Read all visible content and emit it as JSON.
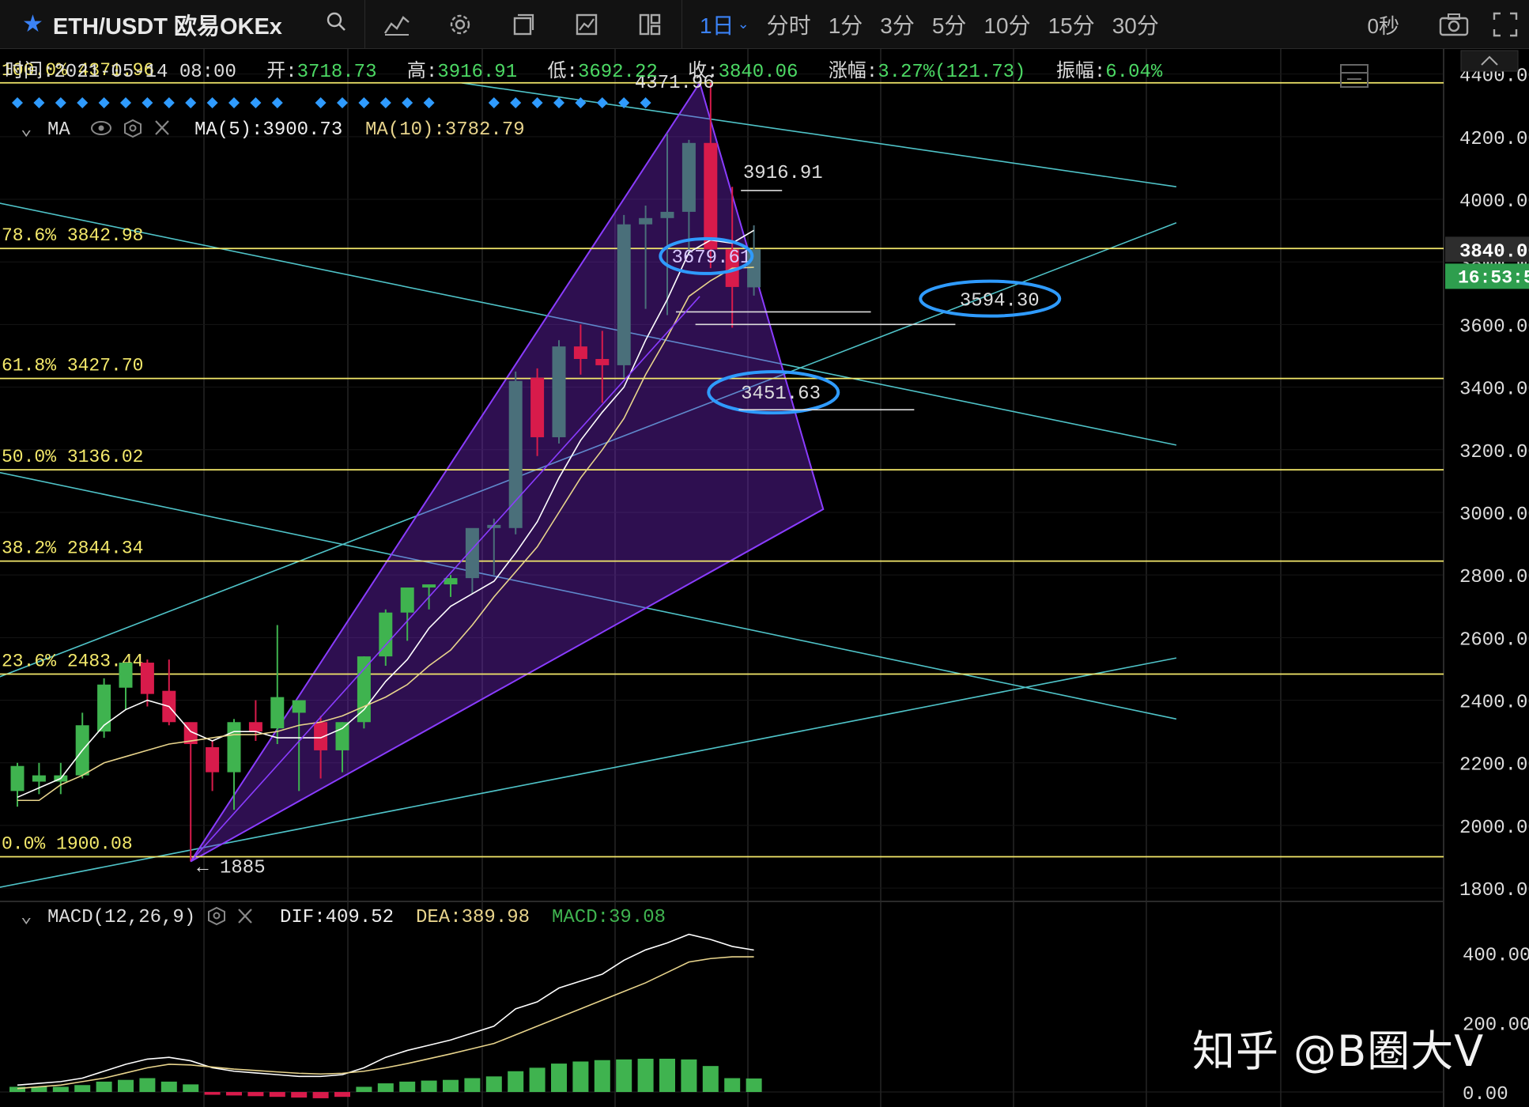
{
  "toolbar": {
    "symbol": "ETH/USDT 欧易OKEx",
    "intervals": [
      "1日",
      "分时",
      "1分",
      "3分",
      "5分",
      "10分",
      "15分",
      "30分"
    ],
    "active_interval": "1日",
    "countdown": "0秒"
  },
  "ohlc_bar": {
    "time_label": "时间:",
    "time": "2021-05-14 08:00",
    "open_label": "开:",
    "open": "3718.73",
    "high_label": "高:",
    "high": "3916.91",
    "low_label": "低:",
    "low": "3692.22",
    "close_label": "收:",
    "close": "3840.06",
    "change_label": "涨幅:",
    "change": "3.27%(121.73)",
    "amplitude_label": "振幅:",
    "amplitude": "6.04%"
  },
  "ma_legend": {
    "name": "MA",
    "ma5": "MA(5):3900.73",
    "ma10": "MA(10):3782.79"
  },
  "macd_legend": {
    "name": "MACD(12,26,9)",
    "dif": "DIF:409.52",
    "dea": "DEA:389.98",
    "macd": "MACD:39.08"
  },
  "price_axis": {
    "ticks": [
      "4400.00",
      "4200.00",
      "4000.00",
      "3800.00",
      "3600.00",
      "3400.00",
      "3200.00",
      "3000.00",
      "2800.00",
      "2600.00",
      "2400.00",
      "2200.00",
      "2000.00",
      "1800.00"
    ],
    "last_price": "3840.06",
    "countdown": "16:53:52"
  },
  "macd_axis": {
    "ticks": [
      "400.00",
      "200.00",
      "0.00"
    ]
  },
  "fib_levels": [
    {
      "label": "100.0% 4371.96",
      "value": 4371.96
    },
    {
      "label": "78.6% 3842.98",
      "value": 3842.98
    },
    {
      "label": "61.8% 3427.70",
      "value": 3427.7
    },
    {
      "label": "50.0% 3136.02",
      "value": 3136.02
    },
    {
      "label": "38.2% 2844.34",
      "value": 2844.34
    },
    {
      "label": "23.6% 2483.44",
      "value": 2483.44
    },
    {
      "label": "0.0% 1900.08",
      "value": 1900.08
    }
  ],
  "annotations": {
    "peak": "4371.96",
    "low_mark": "1885",
    "high_label": "3916.91",
    "support_1": "3679.61",
    "support_2": "3594.30",
    "support_3": "3451.63"
  },
  "watermark": "知乎 @B圈大V",
  "colors": {
    "up": "#3fb34f",
    "down": "#d81b4b",
    "fib": "#f4e96b",
    "trend": "#4fc3c8",
    "triangle": "#8a3cff",
    "marker": "#2f9bff",
    "ma5": "#ffffff",
    "ma10": "#e8d48c",
    "accent": "#3b82f6"
  },
  "chart_data": {
    "type": "candlestick",
    "candles": [
      {
        "o": 2110,
        "h": 2200,
        "l": 2060,
        "c": 2190
      },
      {
        "o": 2140,
        "h": 2200,
        "l": 2100,
        "c": 2160
      },
      {
        "o": 2140,
        "h": 2200,
        "l": 2100,
        "c": 2160
      },
      {
        "o": 2160,
        "h": 2360,
        "l": 2150,
        "c": 2320
      },
      {
        "o": 2300,
        "h": 2470,
        "l": 2280,
        "c": 2450
      },
      {
        "o": 2440,
        "h": 2480,
        "l": 2370,
        "c": 2520
      },
      {
        "o": 2520,
        "h": 2530,
        "l": 2380,
        "c": 2420
      },
      {
        "o": 2430,
        "h": 2530,
        "l": 2320,
        "c": 2330
      },
      {
        "o": 2330,
        "h": 2320,
        "l": 1885,
        "c": 2260
      },
      {
        "o": 2250,
        "h": 2270,
        "l": 2110,
        "c": 2170
      },
      {
        "o": 2170,
        "h": 2340,
        "l": 2050,
        "c": 2330
      },
      {
        "o": 2330,
        "h": 2400,
        "l": 2270,
        "c": 2300
      },
      {
        "o": 2310,
        "h": 2640,
        "l": 2260,
        "c": 2410
      },
      {
        "o": 2360,
        "h": 2390,
        "l": 2110,
        "c": 2400
      },
      {
        "o": 2330,
        "h": 2350,
        "l": 2150,
        "c": 2240
      },
      {
        "o": 2240,
        "h": 2330,
        "l": 2170,
        "c": 2330
      },
      {
        "o": 2330,
        "h": 2540,
        "l": 2310,
        "c": 2540
      },
      {
        "o": 2540,
        "h": 2690,
        "l": 2510,
        "c": 2680
      },
      {
        "o": 2680,
        "h": 2760,
        "l": 2590,
        "c": 2760
      },
      {
        "o": 2760,
        "h": 2770,
        "l": 2690,
        "c": 2770
      },
      {
        "o": 2770,
        "h": 2800,
        "l": 2730,
        "c": 2790
      },
      {
        "o": 2790,
        "h": 2850,
        "l": 2740,
        "c": 2950
      },
      {
        "o": 2950,
        "h": 2980,
        "l": 2800,
        "c": 2960
      },
      {
        "o": 2950,
        "h": 3450,
        "l": 2930,
        "c": 3420
      },
      {
        "o": 3430,
        "h": 3460,
        "l": 3180,
        "c": 3240
      },
      {
        "o": 3240,
        "h": 3550,
        "l": 3220,
        "c": 3530
      },
      {
        "o": 3530,
        "h": 3600,
        "l": 3440,
        "c": 3490
      },
      {
        "o": 3490,
        "h": 3580,
        "l": 3350,
        "c": 3470
      },
      {
        "o": 3470,
        "h": 3950,
        "l": 3430,
        "c": 3920
      },
      {
        "o": 3920,
        "h": 3980,
        "l": 3650,
        "c": 3940
      },
      {
        "o": 3940,
        "h": 4210,
        "l": 3630,
        "c": 3960
      },
      {
        "o": 3960,
        "h": 4190,
        "l": 3820,
        "c": 4180
      },
      {
        "o": 4180,
        "h": 4371.96,
        "l": 3780,
        "c": 3840
      },
      {
        "o": 3840,
        "h": 4040,
        "l": 3590,
        "c": 3720
      },
      {
        "o": 3718.73,
        "h": 3916.91,
        "l": 3692.22,
        "c": 3840.06
      }
    ],
    "ma5": [
      2090,
      2120,
      2150,
      2240,
      2320,
      2370,
      2400,
      2380,
      2300,
      2270,
      2300,
      2300,
      2280,
      2280,
      2280,
      2310,
      2370,
      2460,
      2530,
      2630,
      2700,
      2740,
      2780,
      2870,
      2970,
      3110,
      3230,
      3320,
      3400,
      3550,
      3680,
      3830,
      3870,
      3860,
      3900.73
    ],
    "ma10": [
      2080,
      2080,
      2130,
      2160,
      2200,
      2220,
      2240,
      2260,
      2270,
      2280,
      2290,
      2290,
      2300,
      2320,
      2330,
      2350,
      2380,
      2410,
      2450,
      2510,
      2560,
      2640,
      2730,
      2810,
      2890,
      3000,
      3110,
      3200,
      3300,
      3440,
      3560,
      3690,
      3740,
      3780,
      3782.79
    ],
    "macd_dif": [
      20,
      25,
      30,
      40,
      60,
      80,
      95,
      100,
      90,
      70,
      60,
      55,
      50,
      45,
      45,
      50,
      70,
      100,
      120,
      135,
      150,
      170,
      190,
      240,
      260,
      300,
      320,
      340,
      380,
      410,
      430,
      455,
      440,
      420,
      409.52
    ],
    "macd_dea": [
      10,
      15,
      20,
      30,
      40,
      55,
      70,
      80,
      78,
      72,
      66,
      62,
      58,
      54,
      52,
      54,
      60,
      70,
      82,
      96,
      110,
      125,
      140,
      165,
      190,
      215,
      240,
      265,
      290,
      315,
      345,
      375,
      385,
      390,
      389.98
    ],
    "macd_hist": [
      15,
      15,
      15,
      20,
      30,
      35,
      40,
      30,
      22,
      -8,
      -10,
      -12,
      -14,
      -16,
      -18,
      -14,
      15,
      25,
      30,
      33,
      35,
      40,
      45,
      60,
      70,
      82,
      88,
      92,
      94,
      96,
      96,
      94,
      75,
      40,
      39.08
    ],
    "ylim": [
      1770,
      4480
    ],
    "macd_ylim": [
      -25,
      470
    ]
  }
}
